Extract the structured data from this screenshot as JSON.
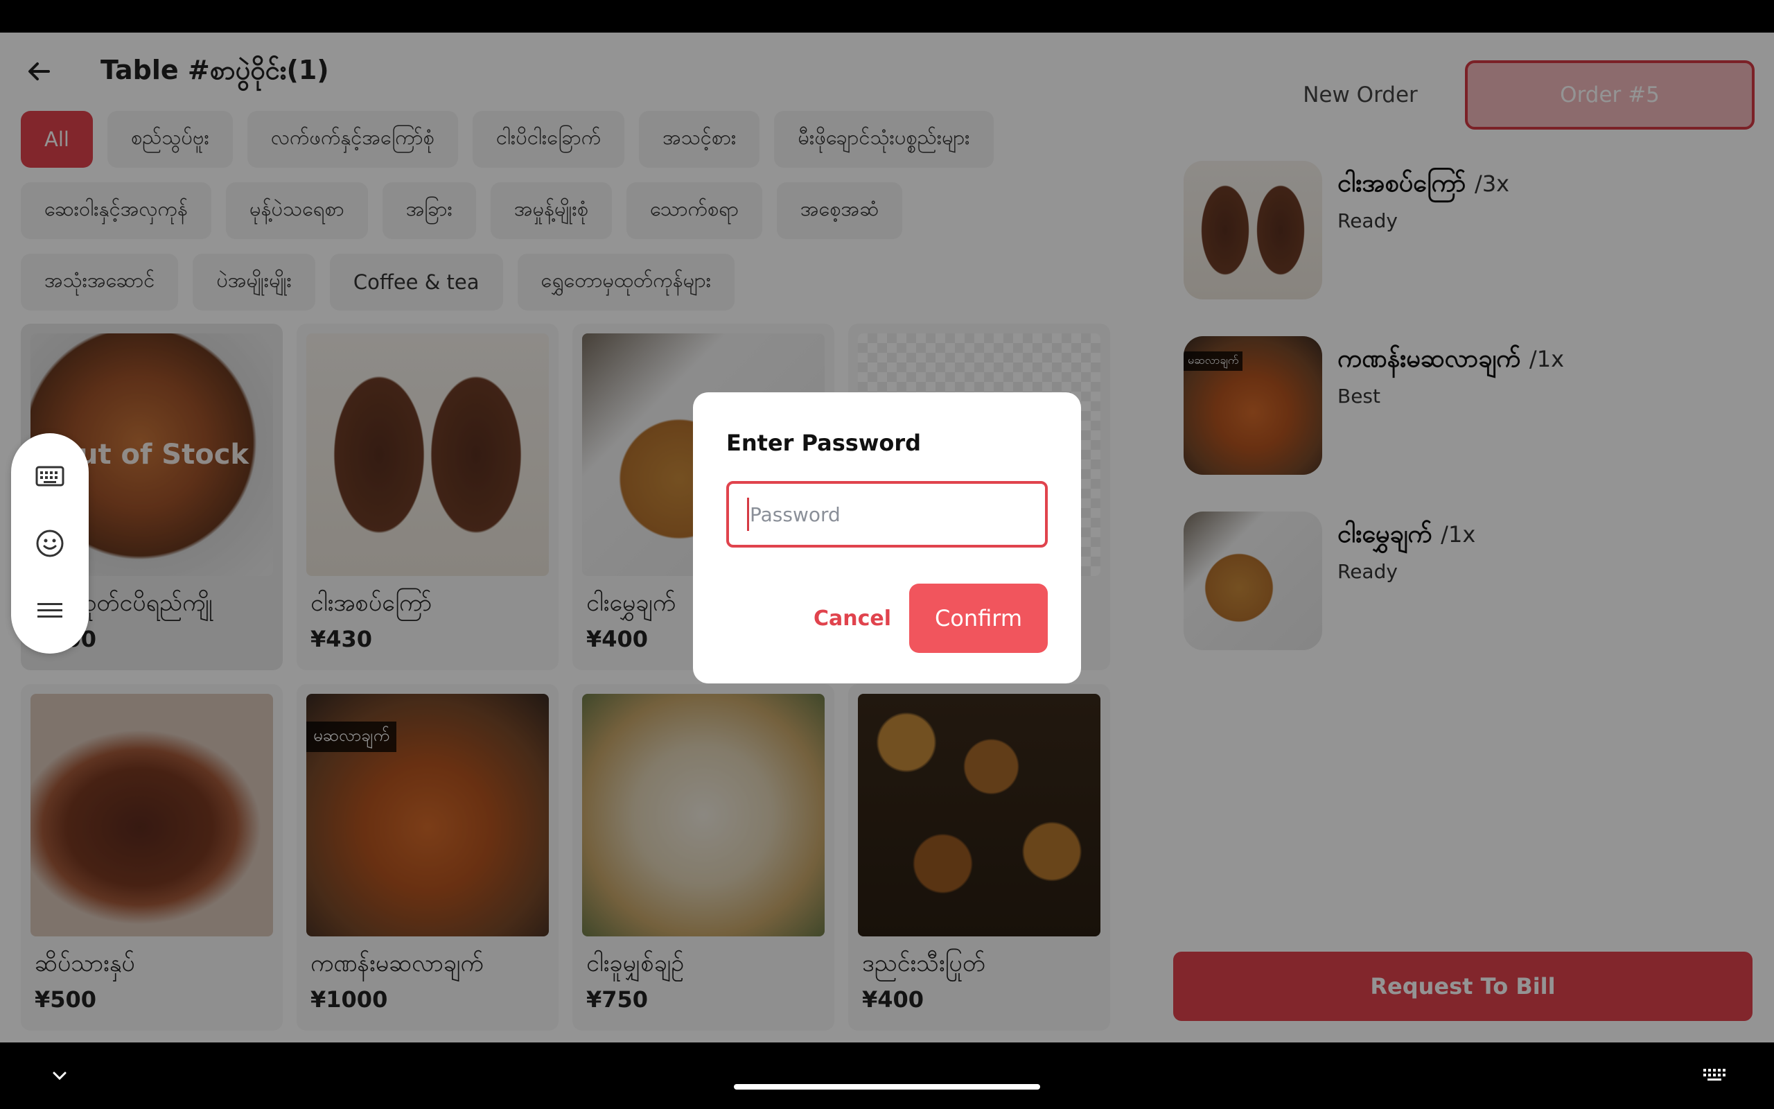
{
  "header": {
    "title": "Table #စာပွဲဝိုင်း(1)"
  },
  "categories": [
    [
      "All",
      "စည်သွပ်ဗူး",
      "လက်ဖက်နှင့်အကြော်စုံ",
      "ငါးပိငါးခြောက်",
      "အသင့်စား",
      "မီးဖိုချောင်သုံးပစ္စည်းများ"
    ],
    [
      "ဆေးဝါးနှင့်အလှကုန်",
      "မုန့်ပဲသရေစာ",
      "အခြား",
      "အမှုန့်မျိုးစုံ",
      "သောက်စရာ",
      "အစေ့အဆံ"
    ],
    [
      "အသုံးအဆောင်",
      "ပဲအမျိုးမျိုး",
      "Coffee & tea",
      "ရွှေတောမှထုတ်ကုန်များ"
    ]
  ],
  "menu": [
    {
      "name": "ပုစွန်တုတ်ငပိရည်ကျို",
      "price": "¥500",
      "oos": "Out of Stock"
    },
    {
      "name": "ငါးအစပ်ကြော်",
      "price": "¥430"
    },
    {
      "name": "ငါးမွှေချက်",
      "price": "¥400"
    },
    {
      "name": "",
      "price": ""
    },
    {
      "name": "ဆိပ်သားနှပ်",
      "price": "¥500"
    },
    {
      "name": "ကဏန်းမဆလာချက်",
      "price": "¥1000",
      "tag": "မဆလာချက်"
    },
    {
      "name": "ငါးခူမျှစ်ချဥ်",
      "price": "¥750"
    },
    {
      "name": "ဒညင်းသီးပြုတ်",
      "price": "¥400"
    }
  ],
  "order_panel": {
    "tab_new": "New Order",
    "tab_order": "Order #5",
    "items": [
      {
        "name": "ငါးအစပ်ကြော်",
        "qty": "/3x",
        "status": "Ready"
      },
      {
        "name": "ကဏန်းမဆလာချက်",
        "qty": "/1x",
        "status": "Best",
        "tag": "မဆလာချက်"
      },
      {
        "name": "ငါးမွှေချက်",
        "qty": "/1x",
        "status": "Ready"
      }
    ],
    "bill_button": "Request To Bill"
  },
  "dialog": {
    "title": "Enter Password",
    "placeholder": "Password",
    "cancel": "Cancel",
    "confirm": "Confirm"
  },
  "toolbar": {
    "icons": [
      "keyboard-icon",
      "emoji-icon",
      "menu-icon"
    ]
  },
  "colors": {
    "accent": "#e0434d",
    "accent_light": "#f1555d"
  }
}
